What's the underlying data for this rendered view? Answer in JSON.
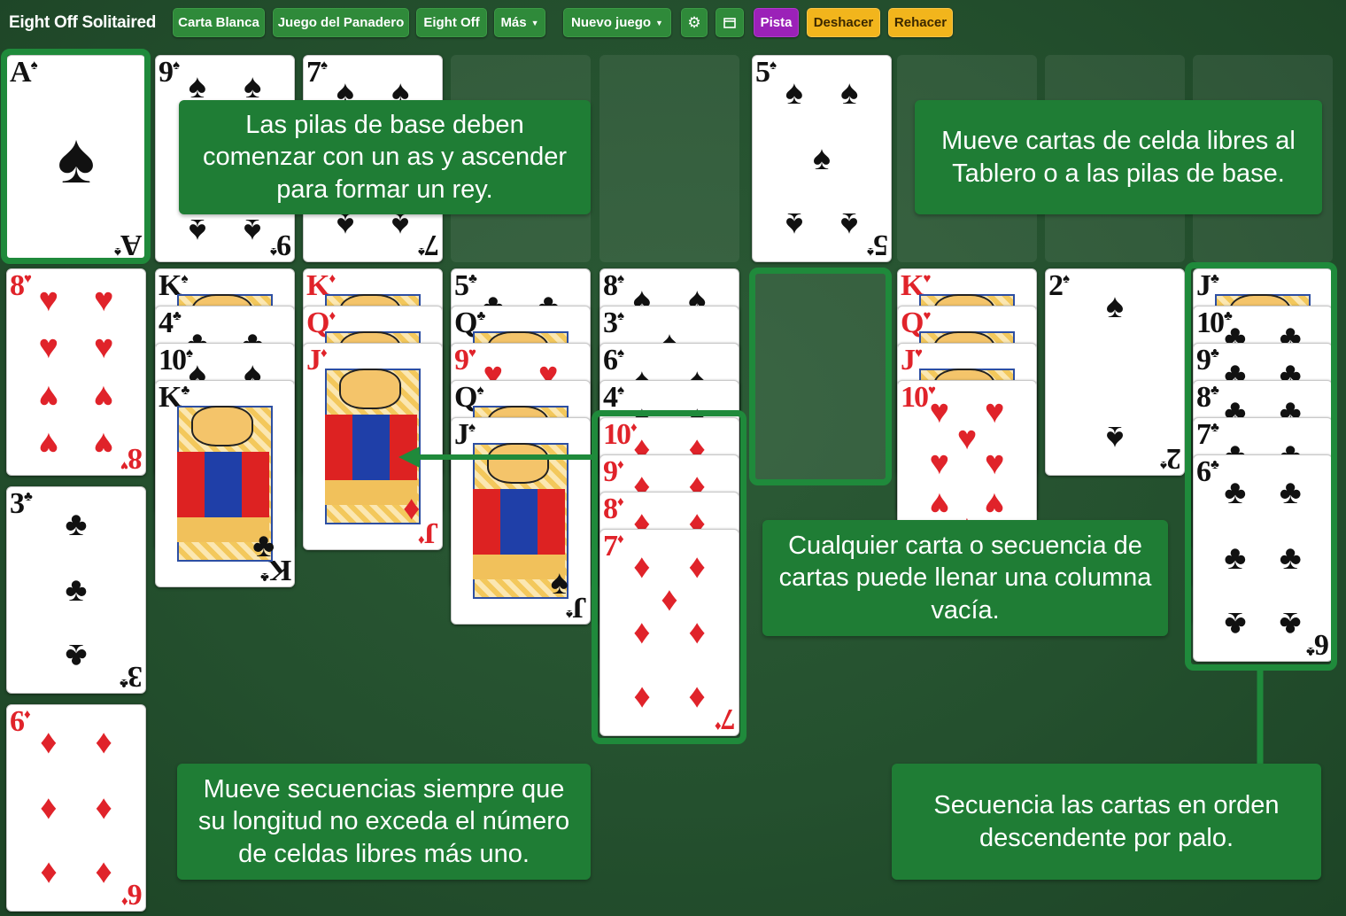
{
  "topbar": {
    "title": "Eight Off Solitaired",
    "btn_carta_blanca": "Carta Blanca",
    "btn_panadero": "Juego del Panadero",
    "btn_eight_off": "Eight Off",
    "btn_mas": "Más",
    "btn_nuevo": "Nuevo juego",
    "btn_pista": "Pista",
    "btn_deshacer": "Deshacer",
    "btn_rehacer": "Rehacer"
  },
  "icons": {
    "settings": "gear-icon",
    "layout": "window-icon",
    "dropdown": "chevron-down-icon"
  },
  "colors": {
    "felt": "#234e2e",
    "button_green": "#2f8a3a",
    "pista": "#9b21b8",
    "undo_redo": "#f2b51c",
    "tip": "#1f7d35",
    "highlight": "#1f8a3b",
    "red_suit": "#e0232a"
  },
  "top_row": [
    {
      "rank": "A",
      "suit": "♠",
      "color": "black"
    },
    {
      "rank": "9",
      "suit": "♠",
      "color": "black"
    },
    {
      "rank": "7",
      "suit": "♠",
      "color": "black"
    },
    null,
    null,
    {
      "rank": "5",
      "suit": "♠",
      "color": "black"
    },
    null,
    null,
    null
  ],
  "columns": [
    [
      {
        "rank": "8",
        "suit": "♥"
      },
      {
        "rank": "3",
        "suit": "♣"
      },
      {
        "rank": "6",
        "suit": "♦"
      }
    ],
    [
      {
        "rank": "K",
        "suit": "♠"
      },
      {
        "rank": "4",
        "suit": "♣"
      },
      {
        "rank": "10",
        "suit": "♠"
      },
      {
        "rank": "K",
        "suit": "♣"
      }
    ],
    [
      {
        "rank": "K",
        "suit": "♦"
      },
      {
        "rank": "Q",
        "suit": "♦"
      },
      {
        "rank": "J",
        "suit": "♦"
      }
    ],
    [
      {
        "rank": "5",
        "suit": "♣"
      },
      {
        "rank": "Q",
        "suit": "♣"
      },
      {
        "rank": "9",
        "suit": "♥"
      },
      {
        "rank": "Q",
        "suit": "♠"
      },
      {
        "rank": "J",
        "suit": "♠"
      }
    ],
    [
      {
        "rank": "8",
        "suit": "♠"
      },
      {
        "rank": "3",
        "suit": "♠"
      },
      {
        "rank": "6",
        "suit": "♠"
      },
      {
        "rank": "4",
        "suit": "♠"
      },
      {
        "rank": "10",
        "suit": "♦"
      },
      {
        "rank": "9",
        "suit": "♦"
      },
      {
        "rank": "8",
        "suit": "♦"
      },
      {
        "rank": "7",
        "suit": "♦"
      }
    ],
    [],
    [
      {
        "rank": "K",
        "suit": "♥"
      },
      {
        "rank": "Q",
        "suit": "♥"
      },
      {
        "rank": "J",
        "suit": "♥"
      },
      {
        "rank": "10",
        "suit": "♥"
      }
    ],
    [
      {
        "rank": "2",
        "suit": "♠"
      }
    ],
    [
      {
        "rank": "J",
        "suit": "♣"
      },
      {
        "rank": "10",
        "suit": "♣"
      },
      {
        "rank": "9",
        "suit": "♣"
      },
      {
        "rank": "8",
        "suit": "♣"
      },
      {
        "rank": "7",
        "suit": "♣"
      },
      {
        "rank": "6",
        "suit": "♣"
      }
    ]
  ],
  "tips": {
    "foundation": "Las pilas de base deben comenzar con un as y ascender para formar un rey.",
    "freecell": "Mueve cartas de celda libres al Tablero o a las pilas de base.",
    "empty_column": "Cualquier carta o secuencia de cartas puede llenar una columna vacía.",
    "move_sequence": "Mueve secuencias siempre que su longitud no exceda el número de celdas libres más uno.",
    "descending": "Secuencia las cartas en orden descendente por palo."
  }
}
